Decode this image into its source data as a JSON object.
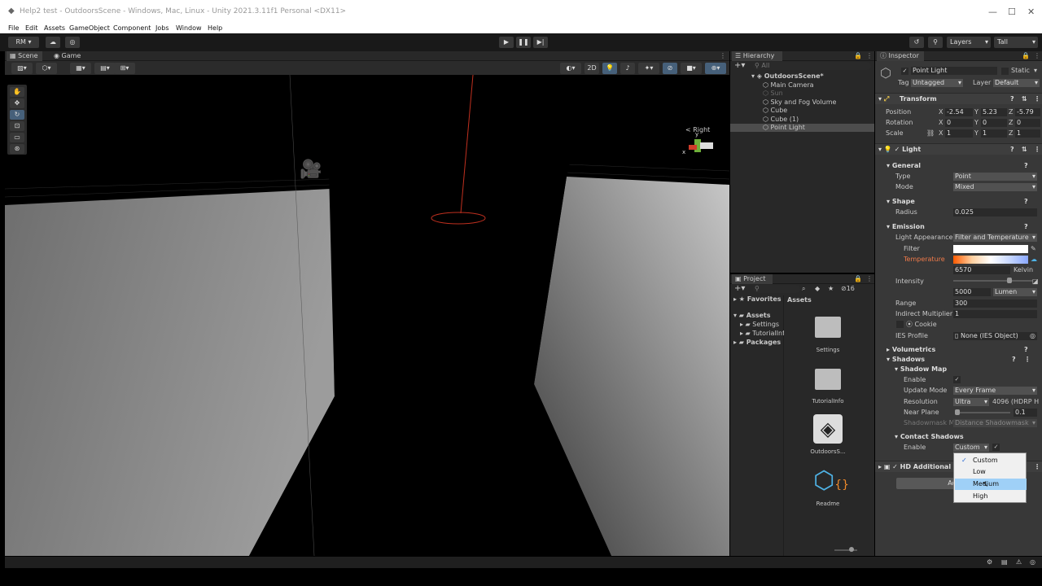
{
  "window": {
    "title": "Help2 test - OutdoorsScene - Windows, Mac, Linux - Unity 2021.3.11f1 Personal <DX11>"
  },
  "menu": [
    "File",
    "Edit",
    "Assets",
    "GameObject",
    "Component",
    "Jobs",
    "Window",
    "Help"
  ],
  "toolbar": {
    "account": "RM",
    "layers": "Layers",
    "layout": "Tall"
  },
  "scene": {
    "tab_scene": "Scene",
    "tab_game": "Game",
    "mode_2d": "2D",
    "gizmo_label": "< Right"
  },
  "hierarchy": {
    "tab": "Hierarchy",
    "search": "All",
    "items": [
      {
        "label": "OutdoorsScene*",
        "indent": 0
      },
      {
        "label": "Main Camera",
        "indent": 1
      },
      {
        "label": "Sun",
        "indent": 1,
        "dim": true
      },
      {
        "label": "Sky and Fog Volume",
        "indent": 1
      },
      {
        "label": "Cube",
        "indent": 1
      },
      {
        "label": "Cube (1)",
        "indent": 1
      },
      {
        "label": "Point Light",
        "indent": 1,
        "selected": true
      }
    ]
  },
  "project": {
    "tab": "Project",
    "count": "16",
    "favorites": "Favorites",
    "assets": "Assets",
    "tree": [
      "Assets",
      "Settings",
      "TutorialInfo",
      "Packages"
    ],
    "breadcrumb": "Assets",
    "files": [
      "Settings",
      "TutorialInfo",
      "OutdoorsS...",
      "Readme"
    ]
  },
  "inspector": {
    "tab": "Inspector",
    "object_name": "Point Light",
    "static": "Static",
    "tag_label": "Tag",
    "tag": "Untagged",
    "layer_label": "Layer",
    "layer": "Default",
    "transform": {
      "title": "Transform",
      "position": "Position",
      "rotation": "Rotation",
      "scale": "Scale",
      "px": "-2.54",
      "py": "5.23",
      "pz": "-5.79",
      "rx": "0",
      "ry": "0",
      "rz": "0",
      "sx": "1",
      "sy": "1",
      "sz": "1"
    },
    "light": {
      "title": "Light",
      "general": "General",
      "type_label": "Type",
      "type": "Point",
      "mode_label": "Mode",
      "mode": "Mixed",
      "shape": "Shape",
      "radius_label": "Radius",
      "radius": "0.025",
      "emission": "Emission",
      "appearance_label": "Light Appearance",
      "appearance": "Filter and Temperature",
      "filter_label": "Filter",
      "temperature_label": "Temperature",
      "temperature": "6570",
      "kelvin": "Kelvin",
      "intensity_label": "Intensity",
      "intensity": "5000",
      "intensity_unit": "Lumen",
      "range_label": "Range",
      "range": "300",
      "indirect_label": "Indirect Multiplier",
      "indirect": "1",
      "cookie": "Cookie",
      "ies_label": "IES Profile",
      "ies": "None (IES Object)",
      "volumetrics": "Volumetrics",
      "shadows": "Shadows",
      "shadow_map": "Shadow Map",
      "enable_label": "Enable",
      "update_label": "Update Mode",
      "update": "Every Frame",
      "resolution_label": "Resolution",
      "resolution": "Ultra",
      "resolution_value": "4096 (HDRP H",
      "near_label": "Near Plane",
      "near": "0.1",
      "shadowmask_label": "Shadowmask M",
      "shadowmask": "Distance Shadowmask",
      "contact": "Contact Shadows",
      "contact_enable": "Enable",
      "contact_value": "Custom"
    },
    "hd_additional": "HD Additional",
    "add_component": "Add C"
  },
  "dropdown": {
    "options": [
      "Custom",
      "Low",
      "Medium",
      "High"
    ],
    "checked": "Custom",
    "hovered": "Medium"
  }
}
